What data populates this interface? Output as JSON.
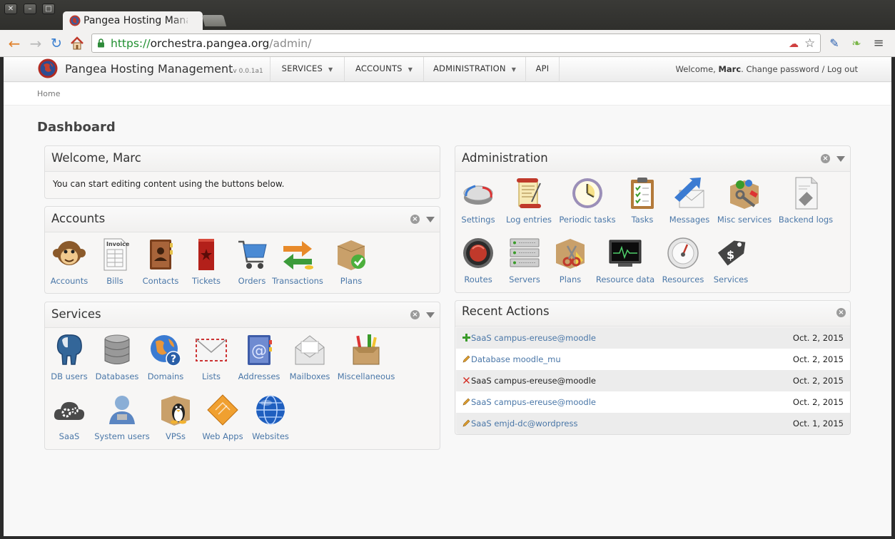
{
  "browser": {
    "tab_title": "Pangea Hosting Mana",
    "window_buttons": [
      "✕",
      "–",
      "□"
    ],
    "url_scheme": "https://",
    "url_host": "orchestra.pangea.org",
    "url_path": "/admin/"
  },
  "header": {
    "brand": "Pangea Hosting Management",
    "version": "v 0.0.1a1",
    "menu": [
      {
        "label": "SERVICES",
        "has_caret": true
      },
      {
        "label": "ACCOUNTS",
        "has_caret": true
      },
      {
        "label": "ADMINISTRATION",
        "has_caret": true
      },
      {
        "label": "API",
        "has_caret": false
      }
    ],
    "welcome_prefix": "Welcome,",
    "user_name": "Marc",
    "change_password": "Change password",
    "separator": "/",
    "logout": "Log out"
  },
  "breadcrumb": "Home",
  "page_title": "Dashboard",
  "welcome_panel": {
    "title": "Welcome, Marc",
    "text": "You can start editing content using the buttons below."
  },
  "accounts_panel": {
    "title": "Accounts",
    "items": [
      {
        "label": "Accounts",
        "icon": "monkey-icon"
      },
      {
        "label": "Bills",
        "icon": "invoice-icon"
      },
      {
        "label": "Contacts",
        "icon": "address-book-icon"
      },
      {
        "label": "Tickets",
        "icon": "ticket-icon"
      },
      {
        "label": "Orders",
        "icon": "shopping-cart-icon"
      },
      {
        "label": "Transactions",
        "icon": "transactions-icon"
      },
      {
        "label": "Plans",
        "icon": "plans-box-icon"
      }
    ]
  },
  "services_panel": {
    "title": "Services",
    "items": [
      {
        "label": "DB users",
        "icon": "postgres-elephant-icon"
      },
      {
        "label": "Databases",
        "icon": "database-icon"
      },
      {
        "label": "Domains",
        "icon": "globe-question-icon"
      },
      {
        "label": "Lists",
        "icon": "envelope-icon"
      },
      {
        "label": "Addresses",
        "icon": "at-address-book-icon"
      },
      {
        "label": "Mailboxes",
        "icon": "mailbox-icon"
      },
      {
        "label": "Miscellaneous",
        "icon": "misc-box-icon"
      },
      {
        "label": "SaaS",
        "icon": "cloud-gears-icon"
      },
      {
        "label": "System users",
        "icon": "system-user-icon"
      },
      {
        "label": "VPSs",
        "icon": "tux-box-icon"
      },
      {
        "label": "Web Apps",
        "icon": "web-apps-icon"
      },
      {
        "label": "Websites",
        "icon": "website-globe-icon"
      }
    ]
  },
  "administration_panel": {
    "title": "Administration",
    "items": [
      {
        "label": "Settings",
        "icon": "settings-disk-icon"
      },
      {
        "label": "Log entries",
        "icon": "scroll-icon"
      },
      {
        "label": "Periodic tasks",
        "icon": "clock-icon"
      },
      {
        "label": "Tasks",
        "icon": "clipboard-icon"
      },
      {
        "label": "Messages",
        "icon": "message-arrow-icon"
      },
      {
        "label": "Misc services",
        "icon": "misc-services-icon"
      },
      {
        "label": "Backend logs",
        "icon": "backend-logs-icon"
      },
      {
        "label": "Routes",
        "icon": "routes-icon"
      },
      {
        "label": "Servers",
        "icon": "servers-icon"
      },
      {
        "label": "Plans",
        "icon": "plans-scissors-icon"
      },
      {
        "label": "Resource data",
        "icon": "monitor-icon"
      },
      {
        "label": "Resources",
        "icon": "gauge-icon"
      },
      {
        "label": "Services",
        "icon": "price-tag-icon"
      }
    ]
  },
  "recent_actions": {
    "title": "Recent Actions",
    "rows": [
      {
        "kind": "add",
        "text": "SaaS campus-ereuse@moodle",
        "date": "Oct. 2, 2015"
      },
      {
        "kind": "change",
        "text": "Database moodle_mu",
        "date": "Oct. 2, 2015"
      },
      {
        "kind": "delete",
        "text": "SaaS campus-ereuse@moodle",
        "date": "Oct. 2, 2015"
      },
      {
        "kind": "change",
        "text": "SaaS campus-ereuse@moodle",
        "date": "Oct. 2, 2015"
      },
      {
        "kind": "change",
        "text": "SaaS emjd-dc@wordpress",
        "date": "Oct. 1, 2015"
      }
    ]
  },
  "colors": {
    "link": "#4a77a8",
    "url_secure": "#1f8f2f",
    "add": "#3a9b2a",
    "delete": "#d42a20",
    "change": "#e0a030"
  }
}
